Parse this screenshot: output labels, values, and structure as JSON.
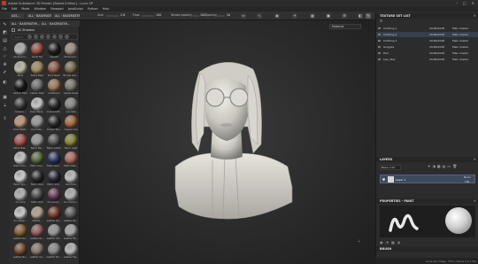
{
  "titlebar": {
    "title": "Adobe Substance 3D Painter [Baked Edition] - Lucie SP",
    "minimize": "–",
    "maximize": "□",
    "close": "✕"
  },
  "menu": [
    "File",
    "Edit",
    "Mode",
    "Window",
    "Viewport",
    "JavaScript",
    "Python",
    "Help"
  ],
  "toolbar": {
    "tabs": [
      "ASS...",
      "ALL · BASEMATER...",
      "ALL · BASEMATER..."
    ],
    "size_label": "Size",
    "size_value": "2.6",
    "flow_label": "Flow",
    "flow_value": "100",
    "stroke_label": "Stroke opacity",
    "stroke_value": "100",
    "spacing_label": "Spacing",
    "spacing_value": "20",
    "size_level": 0.18,
    "flow_level": 1.0,
    "stroke_level": 1.0,
    "spacing_level": 0.2
  },
  "shelf": {
    "tab_label": "ALL · BASEMATER...",
    "tab2_label": "ALL · BASEMATER...",
    "header": "All Shaders",
    "search_placeholder": "Search...",
    "materials": [
      {
        "label": "Aluminium...",
        "color": "#b8b8b8"
      },
      {
        "label": "Aerial Top",
        "color": "#9c4a3a"
      },
      {
        "label": "Asphalt",
        "color": "#1e1e1e"
      },
      {
        "label": "Aluminium...",
        "color": "#a09080"
      },
      {
        "label": "Bone",
        "color": "#c8c2b0"
      },
      {
        "label": "Brass Plate",
        "color": "#a88c56"
      },
      {
        "label": "Brick Basic",
        "color": "#9a5a44"
      },
      {
        "label": "Bronze Arm...",
        "color": "#7a6a4a"
      },
      {
        "label": "Carbon Fiber",
        "color": "#1a1a1a"
      },
      {
        "label": "Carbon Fiber",
        "color": "#6e6e6e"
      },
      {
        "label": "Cardboard",
        "color": "#a47a52"
      },
      {
        "label": "Carpet Grass",
        "color": "#7a7a6a"
      },
      {
        "label": "Ceramic...",
        "color": "#3a3a3a"
      },
      {
        "label": "Clean Plast...",
        "color": "#d0d0d0"
      },
      {
        "label": "Coarse Ruff...",
        "color": "#2a2a2a"
      },
      {
        "label": "Concrete",
        "color": "#8a8a86"
      },
      {
        "label": "Coral Pebbl...",
        "color": "#c89a7a"
      },
      {
        "label": "Concrete...",
        "color": "#9a9a9a"
      },
      {
        "label": "Copper Ste...",
        "color": "#2a2a2a"
      },
      {
        "label": "Copper Lore",
        "color": "#b06a40"
      },
      {
        "label": "Fabric Bas...",
        "color": "#b4504c"
      },
      {
        "label": "Fabric Rib...",
        "color": "#9a9a9a"
      },
      {
        "label": "Fabric Cotton",
        "color": "#555555"
      },
      {
        "label": "Fabric Light",
        "color": "#8a8a2e"
      },
      {
        "label": "Fabric Den...",
        "color": "#cfcfcf"
      },
      {
        "label": "Fabric Den...",
        "color": "#5a6a3a"
      },
      {
        "label": "Fabric Pers...",
        "color": "#2a3a6a"
      },
      {
        "label": "Fabric Plas...",
        "color": "#b46a5a"
      },
      {
        "label": "Fabric Syn...",
        "color": "#d8d8d8"
      },
      {
        "label": "Fabric Wool",
        "color": "#2a2a2a"
      },
      {
        "label": "Fabric Sim...",
        "color": "#2a2a3a"
      },
      {
        "label": "Gold Pure",
        "color": "#c8c8c8"
      },
      {
        "label": "Iron Grid",
        "color": "#bcbcbc"
      },
      {
        "label": "Fabric Rich",
        "color": "#4a4a4a"
      },
      {
        "label": "Iron Grind...",
        "color": "#6a3a5a"
      },
      {
        "label": "Iron Hamm...",
        "color": "#bcbcbc"
      },
      {
        "label": "Iron Silver...",
        "color": "#d4d4d4"
      },
      {
        "label": "Marble...",
        "color": "#b8a890"
      },
      {
        "label": "Leather Tip...",
        "color": "#7a3a2a"
      },
      {
        "label": "Leather Ba...",
        "color": "#5a5a5a"
      },
      {
        "label": "Leather Ro...",
        "color": "#8a6030"
      },
      {
        "label": "Leather Ro...",
        "color": "#9a5a5a"
      },
      {
        "label": "Leather Sof...",
        "color": "#9a9a9a"
      },
      {
        "label": "Leather Fib...",
        "color": "#aaaaaa"
      },
      {
        "label": "Leather Nu...",
        "color": "#7a4a2a"
      },
      {
        "label": "Leather Ca...",
        "color": "#8a7a6a"
      },
      {
        "label": "Leather Sm...",
        "color": "#8a8a8a"
      },
      {
        "label": "Leather Sty...",
        "color": "#c0c0c0"
      }
    ]
  },
  "viewport": {
    "mode_dropdown": "Material"
  },
  "texture_set_list": {
    "title": "TEXTURE SET LIST",
    "rows": [
      {
        "name": "Clothing 1",
        "res": "2048x2048",
        "shader": "Main shader"
      },
      {
        "name": "Clothing 2",
        "res": "2048x2048",
        "shader": "Main shader"
      },
      {
        "name": "Clothing 3",
        "res": "2048x2048",
        "shader": "Main shader"
      },
      {
        "name": "Goggles",
        "res": "2048x2048",
        "shader": "Main shader"
      },
      {
        "name": "Hair",
        "res": "2048x2048",
        "shader": "Main shader"
      },
      {
        "name": "Lips_Tear",
        "res": "2048x2048",
        "shader": "Main shader"
      }
    ]
  },
  "layers": {
    "title": "LAYERS",
    "blend_dropdown": "Base color",
    "layer_name": "Layer 1",
    "blend_mode": "Norm",
    "opacity": "100"
  },
  "properties": {
    "title": "PROPERTIES - PAINT"
  },
  "brush": {
    "title": "BRUSH"
  },
  "status": {
    "text": "Lucie-Girl image · 57% / Ozone 5.1.1 Fps"
  }
}
